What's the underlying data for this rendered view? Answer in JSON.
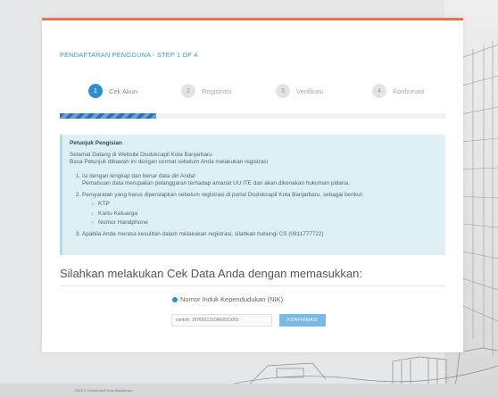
{
  "page": {
    "title": "PENDAFTARAN PENGGUNA - STEP 1 OF 4",
    "accent_color": "#e8734a",
    "primary_color": "#2f8fcc"
  },
  "steps": [
    {
      "num": "1",
      "label": "Cek Akun",
      "active": true
    },
    {
      "num": "2",
      "label": "Registrasi",
      "active": false
    },
    {
      "num": "3",
      "label": "Verifikasi",
      "active": false
    },
    {
      "num": "4",
      "label": "Konfirmasi",
      "active": false
    }
  ],
  "progress": {
    "fraction": 0.25
  },
  "info": {
    "title": "Petunjuk Pengisian",
    "line1": "Selamat Datang di Website Disdukcapil Kota Banjarbaru",
    "line2": "Baca Petunjuk dibawah ini dengan cermat sebelum Anda melakukan registrasi",
    "item1a": "Isi dengan lengkap dan benar data diri Anda!",
    "item1b": "Pemalsuan data merupakan pelanggaran terhadap amanat UU ITE dan akan dikenakan hukuman pidana.",
    "item2": "Persyaratan yang harus dipersiapkan sebelum registrasi di portal Disdukcapil Kota Banjarbaru, sebagai berikut:",
    "requirements": [
      "KTP",
      "Kartu Keluarga",
      "Nomor Handphone"
    ],
    "item3": "Apabila Anda merasa kesulitan dalam melakukan registrasi, silahkan hubungi CS (0811777722)"
  },
  "check": {
    "title": "Silahkan melakukan Cek Data Anda dengan memasukkan:",
    "radio_label": "Nomor Induk Kependudukan (NIK)",
    "input_placeholder": "contoh: 1976021310960021001",
    "button_label": "KONFIRMASI"
  },
  "footer": {
    "text": "2015 © Disdukcapil Kota Banjarbaru"
  }
}
